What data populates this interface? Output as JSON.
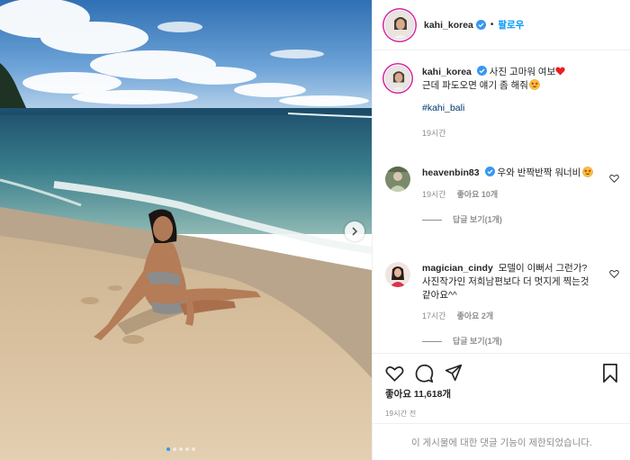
{
  "header": {
    "username": "kahi_korea",
    "separator": "•",
    "follow_label": "팔로우"
  },
  "caption": {
    "username": "kahi_korea",
    "text": "사진 고마워 여보",
    "text2": "근데 파도오면 얘기 좀 해줘",
    "hashtag": "#kahi_bali",
    "time": "19시간"
  },
  "comments": [
    {
      "username": "heavenbin83",
      "text": "우와 반짝반짝 워너비",
      "time": "19시간",
      "likes": "좋아요 10개",
      "replies": "답글 보기(1개)"
    },
    {
      "username": "magician_cindy",
      "text": "모델이 이뻐서 그런가? 사진작가인 저희남편보다 더 멋지게 찍는것같아요^^",
      "time": "17시간",
      "likes": "좋아요 2개",
      "replies": "답글 보기(1개)"
    }
  ],
  "actions": {
    "likes_count": "좋아요 11,618개",
    "date": "19시간 전"
  },
  "comment_disabled": "이 게시물에 대한 댓글 기능이 제한되었습니다.",
  "colors": {
    "link_blue": "#0095f6",
    "hashtag": "#00376b",
    "verified": "#3897f0",
    "heart_red": "#ed1c24",
    "muted": "#8e8e8e"
  },
  "icons": [
    "verified-icon",
    "red-heart-emoji",
    "star-eyes-emoji",
    "heart-icon",
    "comment-icon",
    "share-icon",
    "bookmark-icon",
    "chevron-right-icon"
  ],
  "carousel": {
    "total": 5,
    "current": 1
  }
}
